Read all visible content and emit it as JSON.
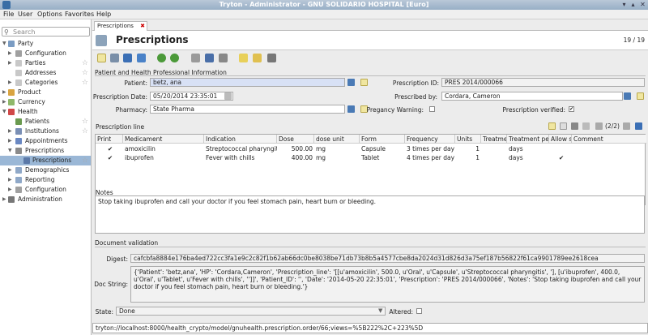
{
  "window": {
    "title": "Tryton - Administrator - GNU SOLIDARIO HOSPITAL [Euro]"
  },
  "menu": [
    "File",
    "User",
    "Options",
    "Favorites",
    "Help"
  ],
  "sidebar": {
    "search_placeholder": "Search",
    "items": [
      {
        "label": "Party"
      },
      {
        "label": "Configuration"
      },
      {
        "label": "Parties"
      },
      {
        "label": "Addresses"
      },
      {
        "label": "Categories"
      },
      {
        "label": "Product"
      },
      {
        "label": "Currency"
      },
      {
        "label": "Health"
      },
      {
        "label": "Patients"
      },
      {
        "label": "Institutions"
      },
      {
        "label": "Appointments"
      },
      {
        "label": "Prescriptions"
      },
      {
        "label": "Prescriptions"
      },
      {
        "label": "Demographics"
      },
      {
        "label": "Reporting"
      },
      {
        "label": "Configuration"
      },
      {
        "label": "Administration"
      }
    ]
  },
  "tab": {
    "label": "Prescriptions"
  },
  "header": {
    "title": "Prescriptions",
    "count": "19 / 19"
  },
  "form": {
    "section_title": "Patient and Health Professional Information",
    "patient_label": "Patient:",
    "patient_value": "betz, ana",
    "prescription_id_label": "Prescription ID:",
    "prescription_id_value": "PRES 2014/000066",
    "prescription_date_label": "Prescription Date:",
    "prescription_date_value": "05/20/2014 23:35:01",
    "prescribed_by_label": "Prescribed by:",
    "prescribed_by_value": "Cordara, Cameron",
    "pharmacy_label": "Pharmacy:",
    "pharmacy_value": "State Pharma",
    "pregnancy_label": "Pregancy Warning:",
    "pregnancy_checked": false,
    "verified_label": "Prescription verified:",
    "verified_checked": true
  },
  "lines": {
    "title": "Prescription line",
    "pager": "(2/2)",
    "columns": [
      "Print",
      "Medicament",
      "Indication",
      "Dose",
      "dose unit",
      "Form",
      "Frequency",
      "Units",
      "Treatme",
      "Treatment pe",
      "Allow s",
      "Comment"
    ],
    "rows": [
      {
        "print": "✔",
        "medicament": "amoxicilin",
        "indication": "Streptococcal pharyngitis",
        "dose": "500.00",
        "unit": "mg",
        "form": "Capsule",
        "frequency": "3 times per day",
        "units": "1",
        "treatment": "",
        "period": "days",
        "allow": "",
        "comment": ""
      },
      {
        "print": "✔",
        "medicament": "ibuprofen",
        "indication": "Fever with chills",
        "dose": "400.00",
        "unit": "mg",
        "form": "Tablet",
        "frequency": "4 times per day",
        "units": "1",
        "treatment": "",
        "period": "days",
        "allow": "✔",
        "comment": ""
      }
    ]
  },
  "notes": {
    "label": "Notes",
    "text": "Stop taking ibuprofen and call your doctor if you feel stomach pain, heart burn or bleeding."
  },
  "validation": {
    "title": "Document validation",
    "digest_label": "Digest:",
    "digest_value": "cafcbfa8884e176ba4ed722cc3fa1e9c2c82f1b62ab66dc0be8038be71db73b8b5a4577cbe8da2024d31d826d3a75ef187b56822f61ca9901789ee2618cea",
    "docstring_label": "Doc String:",
    "docstring_value": "{'Patient': 'betz,ana', 'HP': 'Cordara,Cameron', 'Prescription_line': '[[u'amoxicilin', 500.0, u'Oral', u'Capsule', u'Streptococcal pharyngitis', '], [u'ibuprofen', 400.0, u'Oral', u'Tablet', u'Fever with chills', '']]', 'Patient_ID': '', 'Date': '2014-05-20 22:35:01', 'Prescription': 'PRES 2014/000066', 'Notes': 'Stop taking ibuprofen and call your doctor if you feel stomach pain, heart burn or bleeding.'}",
    "state_label": "State:",
    "state_value": "Done",
    "altered_label": "Altered:",
    "altered_checked": false
  },
  "status": {
    "url": "tryton://localhost:8000/health_crypto/model/gnuhealth.prescription.order/66;views=%5B222%2C+223%5D"
  }
}
